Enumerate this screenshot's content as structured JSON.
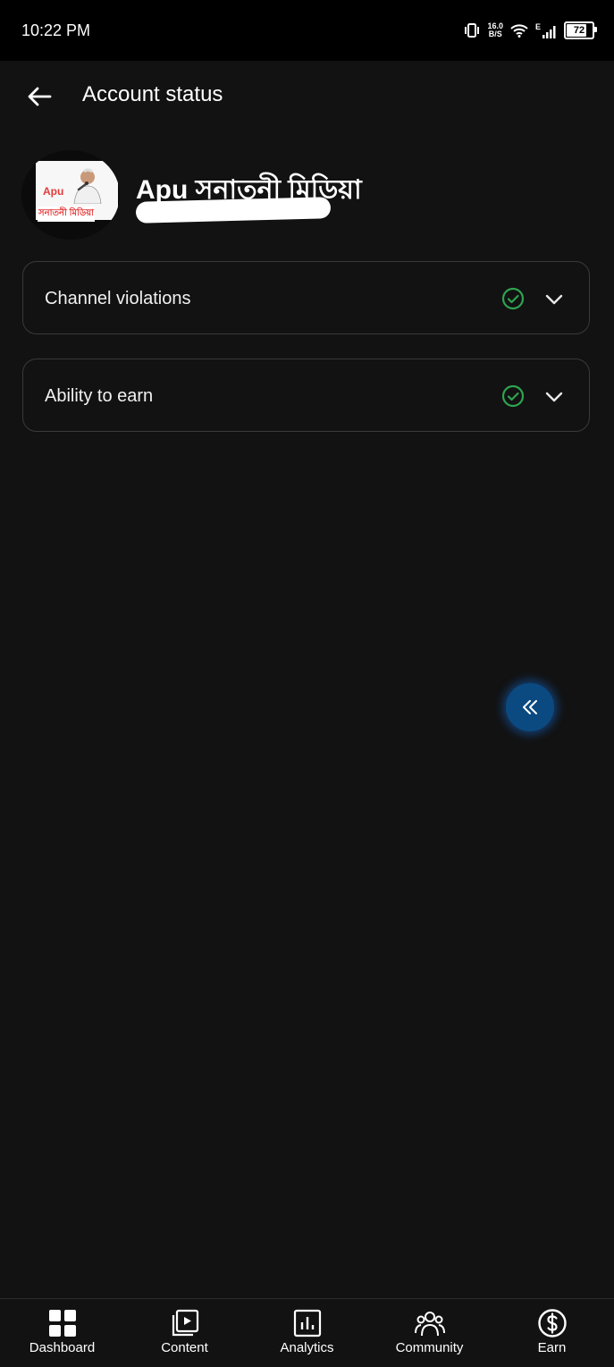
{
  "status_bar": {
    "time": "10:22 PM",
    "net_speed_value": "16.0",
    "net_speed_unit": "B/S",
    "network_type": "E",
    "battery_level": "72"
  },
  "header": {
    "title": "Account status"
  },
  "channel": {
    "name": "Apu সনাতনী মিডিয়া",
    "avatar_tag": "Apu",
    "avatar_caption": "সনাতনী মিডিয়া"
  },
  "status_items": [
    {
      "label": "Channel violations",
      "status": "ok"
    },
    {
      "label": "Ability to earn",
      "status": "ok"
    }
  ],
  "bottom_nav": [
    {
      "label": "Dashboard",
      "icon": "dashboard-icon"
    },
    {
      "label": "Content",
      "icon": "content-icon"
    },
    {
      "label": "Analytics",
      "icon": "analytics-icon"
    },
    {
      "label": "Community",
      "icon": "community-icon"
    },
    {
      "label": "Earn",
      "icon": "earn-icon"
    }
  ],
  "colors": {
    "background": "#121212",
    "check_green": "#2ea44f",
    "fab_blue": "#0b4a80"
  }
}
